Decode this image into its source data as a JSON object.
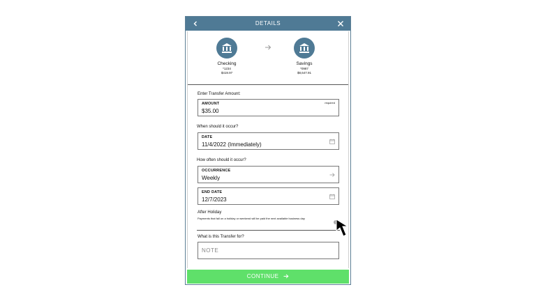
{
  "header": {
    "title": "DETAILS"
  },
  "from_account": {
    "name": "Checking",
    "number": "*1234",
    "balance": "$419.97"
  },
  "to_account": {
    "name": "Savings",
    "number": "*0987",
    "balance": "$8,647.91"
  },
  "amount_section": {
    "heading": "Enter Transfer Amount:",
    "field_label": "AMOUNT",
    "value": "$35.00",
    "required": "required"
  },
  "date_section": {
    "heading": "When should it occur?",
    "field_label": "DATE",
    "value": "11/4/2022 (Immediately)"
  },
  "frequency_section": {
    "heading": "How often should it occur?",
    "field_label": "OCCURRENCE",
    "value": "Weekly"
  },
  "end_date": {
    "field_label": "END DATE",
    "value": "12/7/2023"
  },
  "holiday": {
    "heading": "After Holiday",
    "description": "Payments that fall on a holiday or weekend will be paid the next available business day"
  },
  "note_section": {
    "heading": "What is this Transfer for?",
    "placeholder": "NOTE"
  },
  "continue_label": "CONTINUE",
  "colors": {
    "header": "#4f7a95",
    "continue": "#5fe06a"
  }
}
